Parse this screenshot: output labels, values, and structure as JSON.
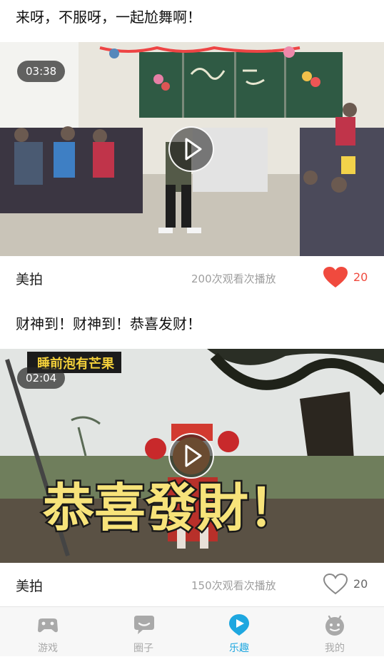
{
  "colors": {
    "like_active": "#f04a3e",
    "like_inactive": "#888888",
    "tab_active": "#1ea7e0",
    "tab_inactive": "#a9a9a9"
  },
  "posts": [
    {
      "title": "来呀，不服呀，一起尬舞啊！",
      "duration": "03:38",
      "source": "美拍",
      "views": "200次观看次播放",
      "likes": "20",
      "liked": true
    },
    {
      "title": "财神到！财神到！恭喜发财！",
      "duration": "02:04",
      "source": "美拍",
      "views": "150次观看次播放",
      "likes": "20",
      "liked": false,
      "banner_text": "恭喜發財！",
      "channel_text": "睡前泡有芒果"
    }
  ],
  "tabbar": {
    "tabs": [
      {
        "label": "游戏",
        "icon": "gamepad-icon",
        "active": false
      },
      {
        "label": "圈子",
        "icon": "chat-bubble-icon",
        "active": false
      },
      {
        "label": "乐趣",
        "icon": "play-location-icon",
        "active": true
      },
      {
        "label": "我的",
        "icon": "android-face-icon",
        "active": false
      }
    ]
  }
}
